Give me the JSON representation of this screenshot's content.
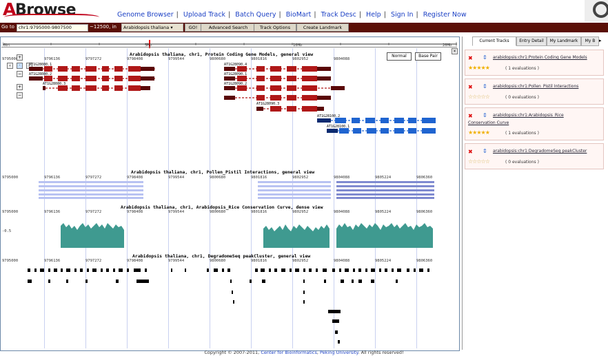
{
  "logo": {
    "accent": "A",
    "rest": "Browse"
  },
  "nav": [
    "Genome Browser",
    "Upload Track",
    "Batch Query",
    "BioMart",
    "Track Desc",
    "Help",
    "Sign In",
    "Register Now"
  ],
  "goto": {
    "label": "Go to",
    "value": "chr1:9795000-9807500",
    "span": "~12500,  in",
    "genome": "Arabidopsis thaliana ▾",
    "buttons": [
      "GO!",
      "Advanced Search",
      "Track Options",
      "Create Landmark"
    ]
  },
  "overview": {
    "left": "0bt",
    "mid1": "5Mb",
    "mid2": "10Mb",
    "right": "20Mb"
  },
  "tracks": {
    "t1": "Arabidopsis thaliana, chr1, Protein Coding Gene Models, general view",
    "t2": "Arabidopsis thaliana, chr1, Pollen_Pistil Interactions, general view",
    "t3": "Arabidopsis thaliana, chr1, Arabidopsis_Rice Conservation Curve, dense view",
    "t4": "Arabidopsis thaliana, chr1, DegradomeSeq peakCluster, general view"
  },
  "ticks": [
    "9795000",
    "9796136",
    "9797272",
    "9798408",
    "9799544",
    "9800680",
    "9801816",
    "9802952",
    "9804088",
    "9805224",
    "9806360"
  ],
  "view_buttons": [
    "Normal",
    "Base Pair"
  ],
  "gene_labels": [
    "AT1G28080.1",
    "AT1G28080.2",
    "AT1G28080.3",
    "AT1G28090.4",
    "AT1G28090.1",
    "AT1G28090.2",
    "AT1G28090.3",
    "AT1G28100.2",
    "AT1G28100.1"
  ],
  "curve_labels": {
    "top": "9795000",
    "mid": "-0.5"
  },
  "right_tabs": [
    "Current Tracks",
    "Entry Detail",
    "My Landmark",
    "My B"
  ],
  "cards": [
    {
      "title": "arabidopsis:chr1:Protein Coding Gene Models",
      "stars": "★★★★★",
      "evals": "( 1 evaluations )"
    },
    {
      "title": "arabidopsis:chr1:Pollen_Pistil Interactions",
      "stars": "☆☆☆☆☆",
      "evals": "( 0 evaluations )"
    },
    {
      "title": "arabidopsis:chr1:Arabidopsis_Rice",
      "title2": "Conservation Curve",
      "stars": "★★★★★",
      "evals": "( 1 evaluations )"
    },
    {
      "title": "arabidopsis:chr1:DegradomeSeq peakCluster",
      "stars": "☆☆☆☆☆",
      "evals": "( 0 evaluations )"
    }
  ],
  "footer": {
    "pre": "Copyright © 2007-2011, ",
    "link1": "Center for Bioinformatics",
    "mid": ", ",
    "link2": "Peking University",
    "post": ". All rights reserved!"
  },
  "colors": {
    "brand": "#c0001a",
    "bar": "#5a0f06",
    "link": "#1a3fc4",
    "gene_red": "#b01818",
    "gene_blue": "#1f64d0",
    "pollen": "#b8c2f2",
    "curve": "#3f9a90"
  }
}
